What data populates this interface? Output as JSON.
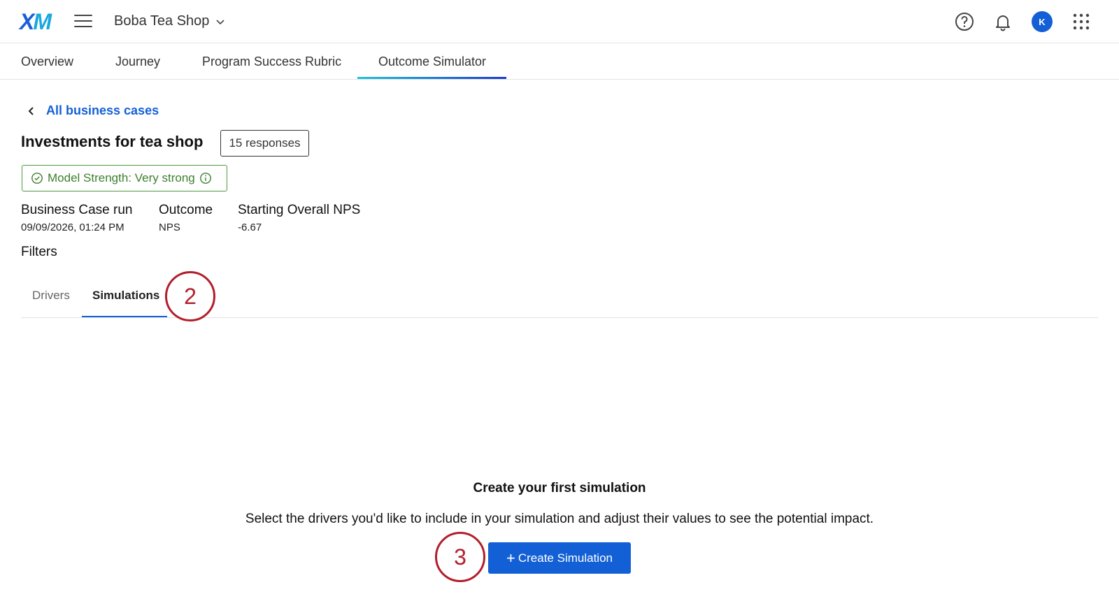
{
  "header": {
    "logo_x": "X",
    "logo_m": "M",
    "project_name": "Boba Tea Shop",
    "avatar_initial": "K",
    "icons": [
      "hamburger-icon",
      "chevron-down-icon",
      "help-icon",
      "bell-icon",
      "apps-grid-icon"
    ]
  },
  "nav": {
    "tabs": [
      {
        "label": "Overview"
      },
      {
        "label": "Journey"
      },
      {
        "label": "Program Success Rubric"
      },
      {
        "label": "Outcome Simulator",
        "active": true
      }
    ]
  },
  "page": {
    "back_label": "All business cases",
    "title": "Investments for tea shop",
    "responses": "15 responses",
    "model_strength": "Model Strength: Very strong",
    "meta": [
      {
        "key": "Business Case run",
        "value": "09/09/2026, 01:24 PM"
      },
      {
        "key": "Outcome",
        "value": "NPS"
      },
      {
        "key": "Starting Overall NPS",
        "value": "-6.67"
      }
    ],
    "filters_label": "Filters"
  },
  "subtabs": {
    "drivers": "Drivers",
    "simulations": "Simulations",
    "active": "Simulations"
  },
  "markers": {
    "step_2": "2",
    "step_3": "3"
  },
  "empty_state": {
    "title": "Create your first simulation",
    "description": "Select the drivers you'd like to include in your simulation and adjust their values to see the potential impact.",
    "button_plus": "+",
    "button_label": "Create Simulation"
  },
  "colors": {
    "accent": "#1360d6",
    "success": "#3d7f2f",
    "marker": "#b11f2c"
  }
}
